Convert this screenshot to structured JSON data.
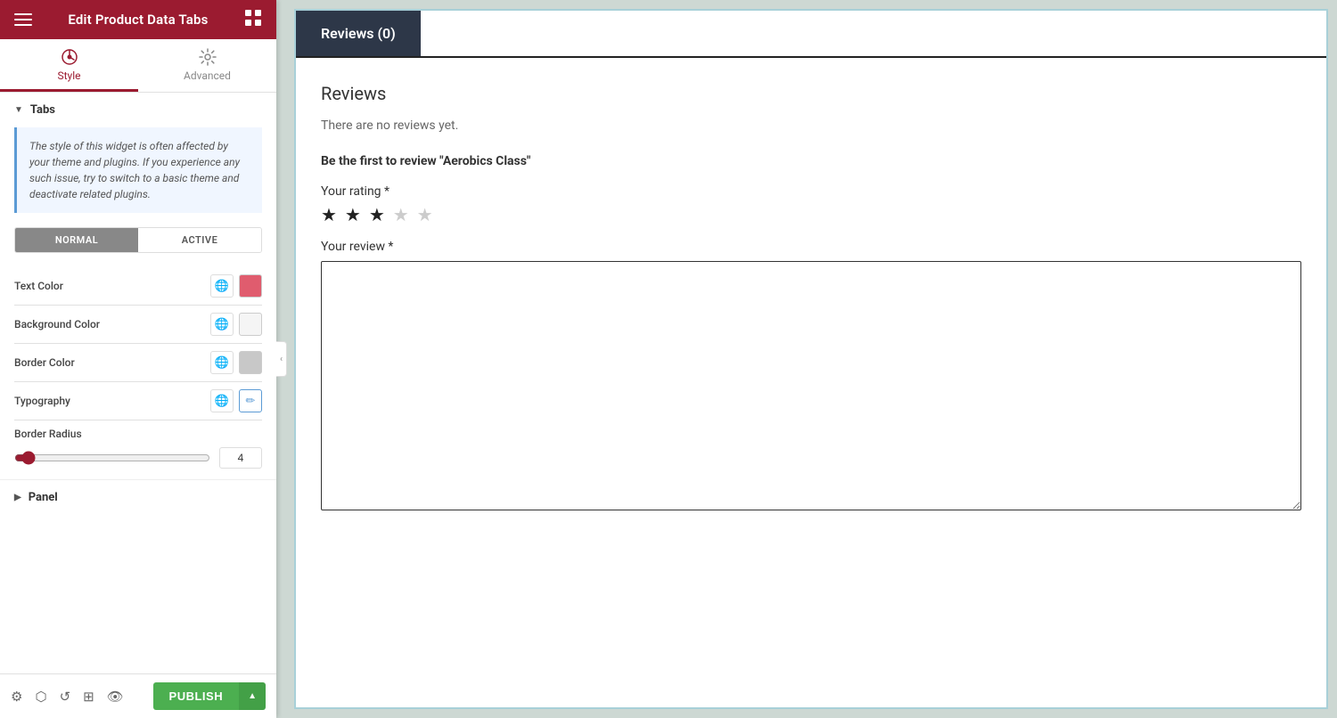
{
  "header": {
    "title": "Edit Product Data Tabs",
    "hamburger_label": "menu",
    "grid_label": "apps"
  },
  "panel_tabs": [
    {
      "id": "style",
      "label": "Style",
      "active": true
    },
    {
      "id": "advanced",
      "label": "Advanced",
      "active": false
    }
  ],
  "tabs_section": {
    "label": "Tabs",
    "collapsed": false,
    "info_text": "The style of this widget is often affected by your theme and plugins. If you experience any such issue, try to switch to a basic theme and deactivate related plugins.",
    "toggle_normal": "NORMAL",
    "toggle_active": "ACTIVE",
    "properties": [
      {
        "id": "text-color",
        "label": "Text Color",
        "swatch_class": "red-swatch"
      },
      {
        "id": "background-color",
        "label": "Background Color",
        "swatch_class": "white-swatch"
      },
      {
        "id": "border-color",
        "label": "Border Color",
        "swatch_class": "gray-swatch"
      },
      {
        "id": "typography",
        "label": "Typography",
        "swatch_class": "blue-swatch"
      }
    ],
    "border_radius": {
      "label": "Border Radius",
      "value": 4,
      "min": 0,
      "max": 100
    }
  },
  "panel_section": {
    "label": "Panel"
  },
  "bottom_toolbar": {
    "publish_label": "PUBLISH"
  },
  "canvas": {
    "tab_label": "Reviews (0)",
    "reviews_title": "Reviews",
    "no_reviews": "There are no reviews yet.",
    "first_review": "Be the first to review \"Aerobics Class\"",
    "rating_label": "Your rating *",
    "stars_filled": 3,
    "stars_total": 5,
    "review_label": "Your review *"
  }
}
